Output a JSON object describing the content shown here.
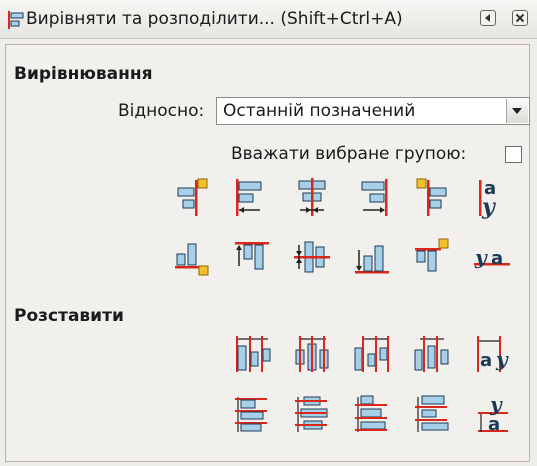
{
  "window": {
    "title": "Вирівняти та розподілити... (Shift+Ctrl+A)",
    "icon": "align-distribute-icon"
  },
  "align": {
    "section_title": "Вирівнювання",
    "relative_label": "Відносно:",
    "relative_value": "Останній позначений",
    "group_label": "Вважати вибране групою:",
    "group_checked": false,
    "rows": [
      [
        "align-right-edge-to-left-anchor-icon",
        "align-left-edges-icon",
        "center-vertical-axis-icon",
        "align-right-edges-icon",
        "align-left-edge-to-right-anchor-icon",
        "align-baseline-text-vertical-icon"
      ],
      [
        "align-bottom-to-top-anchor-icon",
        "align-top-edges-icon",
        "center-horizontal-axis-icon",
        "align-bottom-edges-icon",
        "align-top-to-bottom-anchor-icon",
        "align-baseline-text-horizontal-icon"
      ]
    ]
  },
  "distribute": {
    "section_title": "Розставити",
    "rows": [
      [
        "distribute-left-edges-icon",
        "distribute-centers-horizontal-icon",
        "distribute-right-edges-icon",
        "distribute-gaps-horizontal-icon",
        "distribute-baselines-horizontal-icon"
      ],
      [
        "distribute-top-edges-icon",
        "distribute-centers-vertical-icon",
        "distribute-bottom-edges-icon",
        "distribute-gaps-vertical-icon",
        "distribute-baselines-vertical-icon"
      ]
    ]
  },
  "colors": {
    "bar_fill": "#a8cfe8",
    "bar_stroke": "#1b3a55",
    "guide": "#d8281c",
    "anchor": "#f5c02a"
  }
}
